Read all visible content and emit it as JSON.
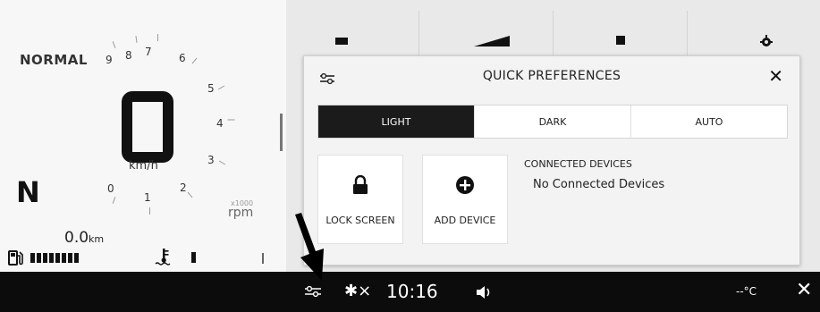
{
  "cluster": {
    "riding_mode": "NORMAL",
    "rpm_numbers": [
      "0",
      "1",
      "2",
      "3",
      "4",
      "5",
      "6",
      "7",
      "8",
      "9"
    ],
    "speed": "0",
    "speed_unit": "km/h",
    "gear": "N",
    "rpm_scale": "x1000",
    "rpm_unit": "rpm",
    "odometer_value": "0.0",
    "odometer_unit": "km",
    "fuel_level_bars": 8
  },
  "panel": {
    "title": "QUICK PREFERENCES",
    "close_glyph": "✕",
    "theme_options": [
      "LIGHT",
      "DARK",
      "AUTO"
    ],
    "theme_selected": "LIGHT",
    "lock_screen_label": "LOCK SCREEN",
    "add_device_label": "ADD DEVICE",
    "connected_devices_heading": "CONNECTED DEVICES",
    "connected_devices_value": "No Connected Devices"
  },
  "status_bar": {
    "bluetooth_glyph": "✱×",
    "time": "10:16",
    "temperature": "--°C",
    "close_glyph": "✕"
  },
  "colors": {
    "active_segment": "#1b1b1b",
    "status_bar_bg": "#0c0c0c",
    "panel_bg": "#f3f3f3"
  },
  "icons": [
    "preferences-sliders-icon",
    "lock-icon",
    "add-circle-icon",
    "bluetooth-off-icon",
    "volume-icon",
    "fuel-pump-icon",
    "coolant-temperature-icon",
    "close-icon",
    "annotation-arrow-icon"
  ]
}
